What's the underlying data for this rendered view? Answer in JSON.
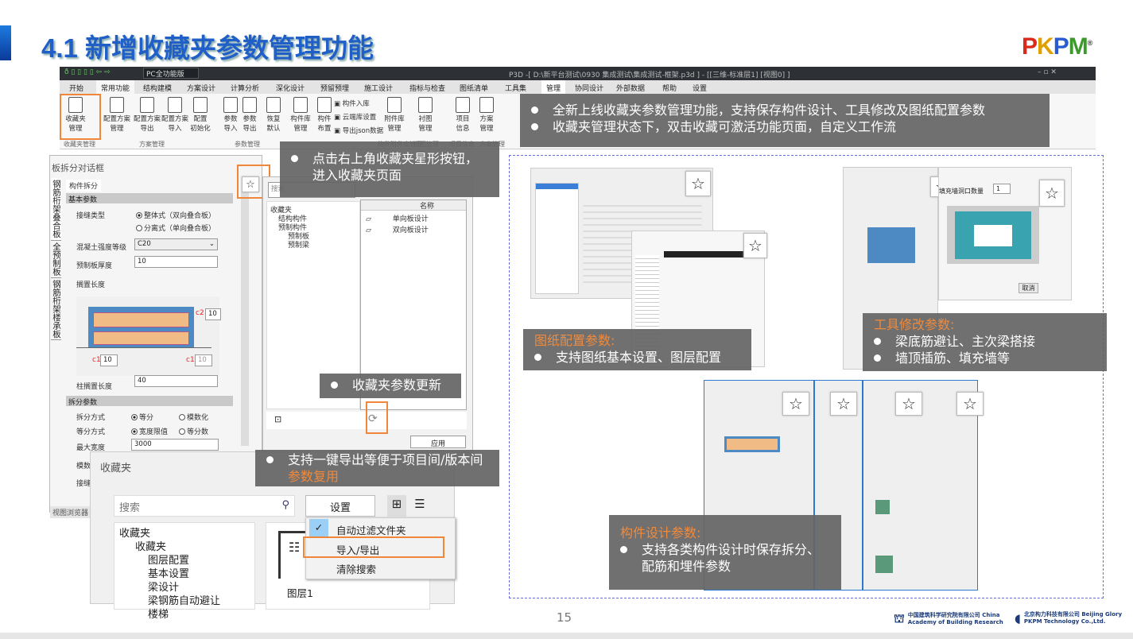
{
  "slide": {
    "title": "4.1 新增收藏夹参数管理功能",
    "page_number": "15",
    "logo": "PKPM",
    "footer_logos": [
      "中国建筑科学研究院有限公司 China Academy of Building Research",
      "北京构力科技有限公司 Beijing Glory PKPM Technology Co.,Ltd."
    ]
  },
  "app": {
    "edition": "PC全功能版",
    "window_title": "P3D -[ D:\\新平台测试\\0930 集成测试\\集成测试-框架.p3d ] - [[三维-标准层1] [视图0] ]",
    "tabs": [
      "开始",
      "常用功能",
      "结构建模",
      "方案设计",
      "计算分析",
      "深化设计",
      "预留预埋",
      "施工设计",
      "指标与检查",
      "图纸清单",
      "工具集",
      "管理",
      "协同设计",
      "外部数据",
      "帮助",
      "设置"
    ],
    "active_tab": "管理",
    "ribbon": [
      {
        "label": "收藏夹\n管理"
      },
      {
        "label": "配置方案\n管理"
      },
      {
        "label": "配置方案\n导出"
      },
      {
        "label": "配置方案\n导入"
      },
      {
        "label": "配置\n初始化"
      },
      {
        "label": "参数\n导入"
      },
      {
        "label": "参数\n导出"
      },
      {
        "label": "恢复\n默认"
      },
      {
        "label": "构件库\n管理"
      },
      {
        "label": "构件\n布置"
      },
      {
        "label": "构件入库"
      },
      {
        "label": "云端库设置"
      },
      {
        "label": "导出json数据"
      },
      {
        "label": "附件库\n管理"
      },
      {
        "label": "衬图\n管理"
      },
      {
        "label": "项目\n信息"
      },
      {
        "label": "方案\n管理"
      }
    ],
    "groups": [
      "收藏夹管理",
      "方案管理",
      "参数管理",
      "构件附件库管理",
      "衬图管理",
      "项目信息",
      "方案管理"
    ]
  },
  "callouts": {
    "top": [
      "全新上线收藏夹参数管理功能，支持保存构件设计、工具修改及图纸配置参数",
      "收藏夹管理状态下，双击收藏可激活功能页面，自定义工作流"
    ],
    "star": "点击右上角收藏夹星形按钮，进入收藏夹页面",
    "update": "收藏夹参数更新",
    "export_a": "支持一键导出等便于项目间/版本间",
    "export_b": "参数复用",
    "drawing_title": "图纸配置参数:",
    "drawing_item": "支持图纸基本设置、图层配置",
    "tool_title": "工具修改参数:",
    "tool_items": [
      "梁底筋避让、主次梁搭接",
      "墙顶插筋、填充墙等"
    ],
    "member_title": "构件设计参数:",
    "member_item": "支持各类构件设计时保存拆分、配筋和埋件参数"
  },
  "slab_dialog": {
    "title": "板拆分对话框",
    "side_tabs": [
      "钢筋桁架叠合板",
      "全预制板",
      "钢筋桁架楼承板"
    ],
    "tab": "构件拆分",
    "basic_section": "基本参数",
    "joint_type": "接缝类型",
    "joint_opt1": "整体式（双向叠合板）",
    "joint_opt2": "分离式（单向叠合板）",
    "concrete_label": "混凝土强度等级",
    "concrete_value": "C20",
    "thickness_label": "预制板厚度",
    "thickness_value": "10",
    "rest_label": "搁置长度",
    "c1": "c1",
    "c2": "c2",
    "c1_value": "10",
    "c1b_value": "10",
    "c2_value": "10",
    "col_rest_label": "柱搁置长度",
    "col_rest_value": "40",
    "split_section": "拆分参数",
    "split_mode": "拆分方式",
    "split_opt1": "等分",
    "split_opt2": "模数化",
    "equal_mode": "等分方式",
    "equal_opt1": "宽度限值",
    "equal_opt2": "等分数",
    "max_width_label": "最大宽度",
    "max_width_value": "3000",
    "modulus_label": "模数",
    "joint_label": "接缝",
    "view_browser": "视图浏览器"
  },
  "fav_panel": {
    "search": "搜索",
    "tree": [
      "收藏夹",
      "结构构件",
      "预制构件",
      "预制板",
      "预制梁"
    ],
    "col_name": "名称",
    "items": [
      "单向板设计",
      "双向板设计"
    ],
    "apply": "应用"
  },
  "fav_dialog": {
    "title": "收藏夹",
    "search_placeholder": "搜索",
    "settings": "设置",
    "tree": [
      "收藏夹",
      "收藏夹",
      "图层配置",
      "基本设置",
      "梁设计",
      "梁钢筋自动避让",
      "楼梯"
    ],
    "file": "图层1",
    "menu": [
      "自动过滤文件夹",
      "导入/导出",
      "清除搜索"
    ]
  },
  "thumbs": {
    "cancel": "取消",
    "opening_count": "填充墙洞口数量",
    "opening_value": "1"
  }
}
